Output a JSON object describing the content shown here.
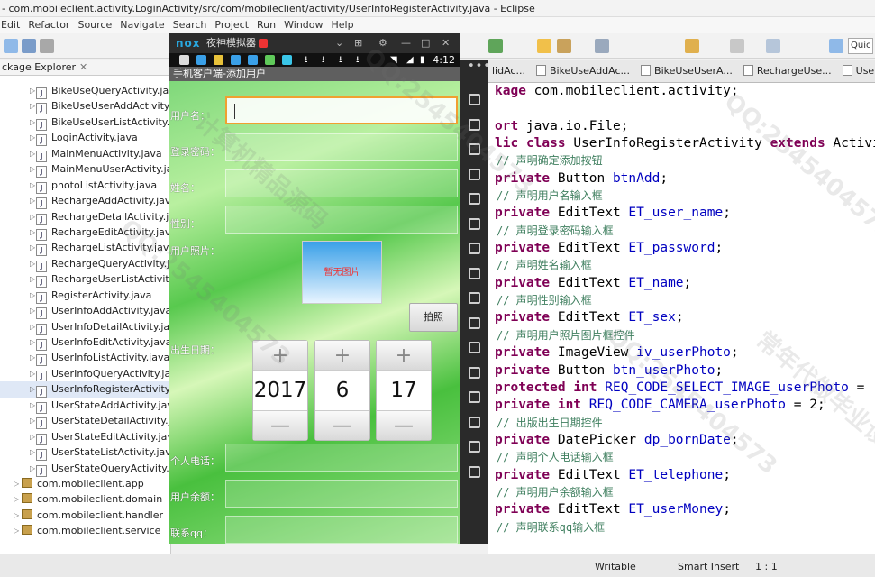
{
  "window": {
    "title": "- com.mobileclient.activity.LoginActivity/src/com/mobileclient/activity/UserInfoRegisterActivity.java - Eclipse"
  },
  "menu": [
    "Edit",
    "Refactor",
    "Source",
    "Navigate",
    "Search",
    "Project",
    "Run",
    "Window",
    "Help"
  ],
  "toolbar": {
    "quick_access": "Quic"
  },
  "package_explorer": {
    "tab_label": "ckage Explorer",
    "close_glyph": "✕",
    "files": [
      "BikeUseQueryActivity.java",
      "BikeUseUserAddActivity.java",
      "BikeUseUserListActivity.java",
      "LoginActivity.java",
      "MainMenuActivity.java",
      "MainMenuUserActivity.java",
      "photoListActivity.java",
      "RechargeAddActivity.java",
      "RechargeDetailActivity.java",
      "RechargeEditActivity.java",
      "RechargeListActivity.java",
      "RechargeQueryActivity.java",
      "RechargeUserListActivity.java",
      "RegisterActivity.java",
      "UserInfoAddActivity.java",
      "UserInfoDetailActivity.java",
      "UserInfoEditActivity.java",
      "UserInfoListActivity.java",
      "UserInfoQueryActivity.java",
      "UserInfoRegisterActivity.java",
      "UserStateAddActivity.java",
      "UserStateDetailActivity.java",
      "UserStateEditActivity.java",
      "UserStateListActivity.java",
      "UserStateQueryActivity.java"
    ],
    "packages": [
      "com.mobileclient.app",
      "com.mobileclient.domain",
      "com.mobileclient.handler",
      "com.mobileclient.service"
    ]
  },
  "emulator": {
    "logo": "nox",
    "name": "夜神模拟器",
    "controls": [
      "⌄",
      "⊞",
      "⚙",
      "—",
      "□",
      "✕"
    ],
    "time": "4:12",
    "app_title": "手机客户端-添加用户",
    "form": {
      "user_name_label": "用户名：",
      "password_label": "登录密码：",
      "name_label": "姓名：",
      "sex_label": "性别：",
      "photo_label": "用户照片：",
      "photo_placeholder": "暂无图片",
      "photo_button": "拍照",
      "birth_label": "出生日期：",
      "phone_label": "个人电话：",
      "money_label": "用户余额：",
      "qq_label": "联系qq："
    },
    "date_picker": {
      "year": "2017",
      "month": "6",
      "day": "17",
      "plus": "+",
      "minus": "—"
    }
  },
  "editor": {
    "tabs": [
      "lidAc...",
      "BikeUseAddAc...",
      "BikeUseUserA...",
      "RechargeUse...",
      "Use"
    ],
    "code": [
      {
        "type": "code",
        "text": "kage com.mobileclient.activity;"
      },
      {
        "type": "code",
        "text": ""
      },
      {
        "type": "code",
        "text": "ort java.io.File;"
      },
      {
        "type": "code",
        "text": "lic class UserInfoRegisterActivity extends Activi"
      },
      {
        "type": "comment",
        "text": "// 声明确定添加按钮"
      },
      {
        "type": "code",
        "text": "private Button btnAdd;"
      },
      {
        "type": "comment",
        "text": "// 声明用户名输入框"
      },
      {
        "type": "code",
        "text": "private EditText ET_user_name;"
      },
      {
        "type": "comment",
        "text": "// 声明登录密码输入框"
      },
      {
        "type": "code",
        "text": "private EditText ET_password;"
      },
      {
        "type": "comment",
        "text": "// 声明姓名输入框"
      },
      {
        "type": "code",
        "text": "private EditText ET_name;"
      },
      {
        "type": "comment",
        "text": "// 声明性别输入框"
      },
      {
        "type": "code",
        "text": "private EditText ET_sex;"
      },
      {
        "type": "comment",
        "text": "// 声明用户照片图片框控件"
      },
      {
        "type": "code",
        "text": "private ImageView iv_userPhoto;"
      },
      {
        "type": "code",
        "text": "private Button btn_userPhoto;"
      },
      {
        "type": "code",
        "text": "protected int REQ_CODE_SELECT_IMAGE_userPhoto ="
      },
      {
        "type": "code",
        "text": "private int REQ_CODE_CAMERA_userPhoto = 2;"
      },
      {
        "type": "comment",
        "text": "// 出版出生日期控件"
      },
      {
        "type": "code",
        "text": "private DatePicker dp_bornDate;"
      },
      {
        "type": "comment",
        "text": "// 声明个人电话输入框"
      },
      {
        "type": "code",
        "text": "private EditText ET_telephone;"
      },
      {
        "type": "comment",
        "text": "// 声明用户余额输入框"
      },
      {
        "type": "code",
        "text": "private EditText ET_userMoney;"
      },
      {
        "type": "comment",
        "text": "// 声明联系qq输入框"
      }
    ]
  },
  "status": {
    "writable": "Writable",
    "insert_mode": "Smart Insert",
    "position": "1 : 1"
  },
  "watermark": {
    "text": "QQ:2545404573",
    "text2": "常年代做毕业设计",
    "text3": "计算机精品源码"
  },
  "colors": {
    "keyword": "#7f0055",
    "field": "#0000c0",
    "comment": "#3f7f5f",
    "focus": "#f0a030"
  }
}
